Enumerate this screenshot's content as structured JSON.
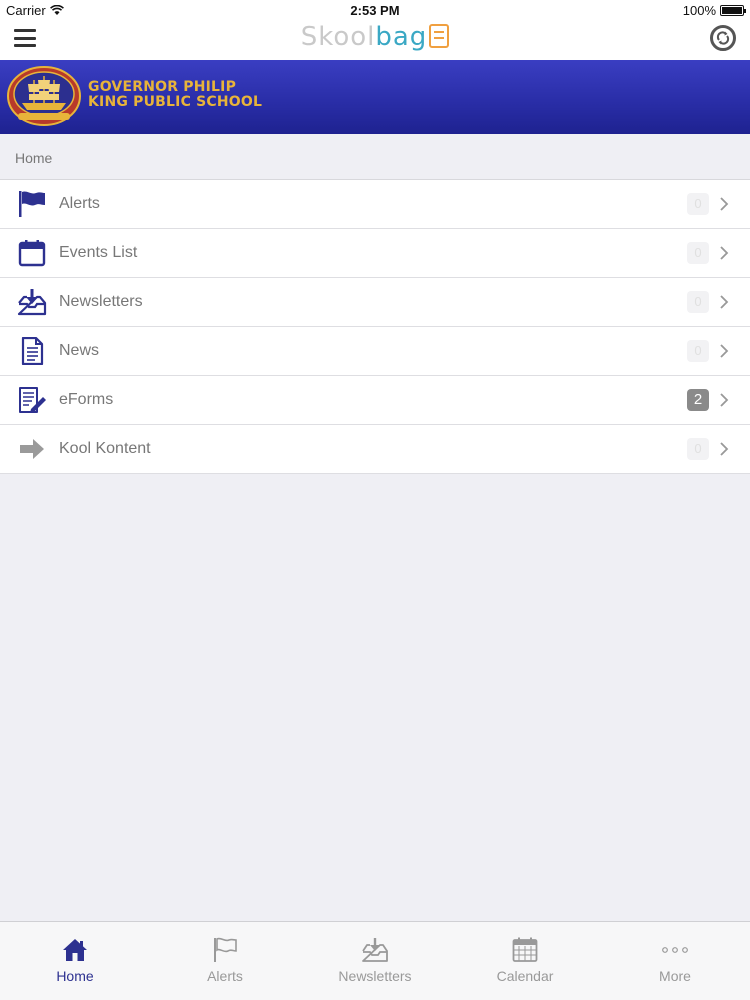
{
  "status_bar": {
    "carrier": "Carrier",
    "time": "2:53 PM",
    "battery": "100%"
  },
  "header": {
    "logo_text_light": "Skool",
    "logo_text_accent": "bag"
  },
  "school": {
    "name_line1": "GOVERNOR PHILIP",
    "name_line2": "KING PUBLIC SCHOOL"
  },
  "breadcrumb": "Home",
  "menu": [
    {
      "label": "Alerts",
      "badge": "0",
      "icon": "flag-icon"
    },
    {
      "label": "Events List",
      "badge": "0",
      "icon": "calendar-icon"
    },
    {
      "label": "Newsletters",
      "badge": "0",
      "icon": "inbox-download-icon"
    },
    {
      "label": "News",
      "badge": "0",
      "icon": "document-icon"
    },
    {
      "label": "eForms",
      "badge": "2",
      "icon": "form-edit-icon"
    },
    {
      "label": "Kool Kontent",
      "badge": "0",
      "icon": "arrow-right-icon"
    }
  ],
  "tabs": [
    {
      "label": "Home",
      "icon": "home-icon",
      "selected": true
    },
    {
      "label": "Alerts",
      "icon": "flag-icon"
    },
    {
      "label": "Newsletters",
      "icon": "inbox-download-icon"
    },
    {
      "label": "Calendar",
      "icon": "calendar-grid-icon"
    },
    {
      "label": "More",
      "icon": "more-dots-icon"
    }
  ],
  "colors": {
    "brand_navy": "#2d3190",
    "banner_blue": "#2a2ea8",
    "school_gold": "#e8b43a",
    "logo_teal": "#3aa8c4",
    "logo_orange": "#f0a040"
  }
}
